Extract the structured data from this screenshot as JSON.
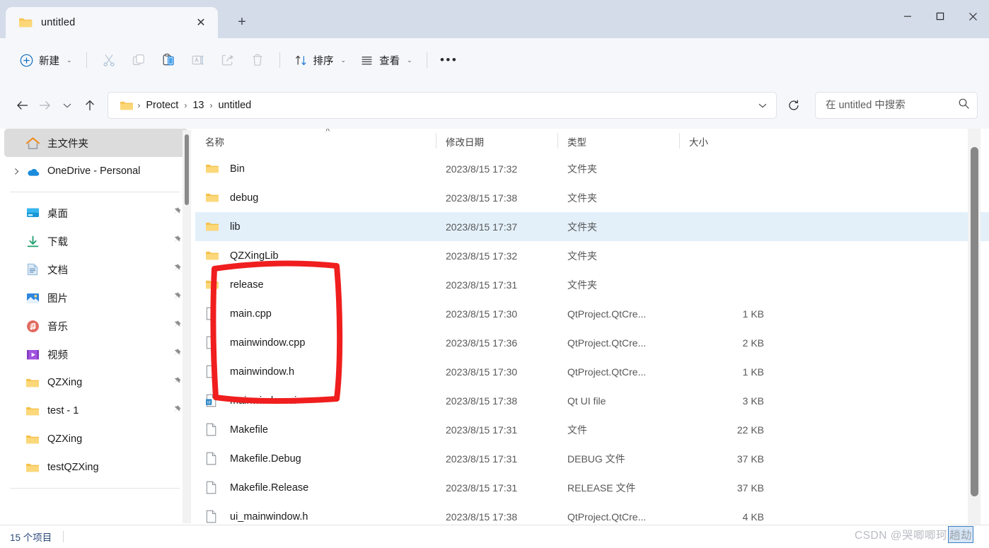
{
  "window": {
    "tab_title": "untitled",
    "tab_close_label": "✕",
    "new_tab_label": "+",
    "minimize_label": "─",
    "maximize_label": "□",
    "close_label": "✕"
  },
  "toolbar": {
    "new_label": "新建",
    "chevron": "⌄",
    "cut_name": "cut-icon",
    "copy_name": "copy-icon",
    "paste_name": "paste-icon",
    "rename_name": "rename-icon",
    "share_name": "share-icon",
    "delete_name": "delete-icon",
    "sort_label": "排序",
    "view_label": "查看",
    "more_label": "•••"
  },
  "address": {
    "back_label": "←",
    "forward_label": "→",
    "recent_label": "⌄",
    "up_label": "↑",
    "refresh_label": "⟳",
    "dropdown_label": "⌄",
    "crumbs": [
      "Protect",
      "13",
      "untitled"
    ],
    "crumb_sep": "›"
  },
  "search": {
    "placeholder": "在 untitled 中搜索",
    "value": "",
    "icon": "search-icon"
  },
  "sidebar": {
    "items": [
      {
        "label": "主文件夹",
        "icon": "home-icon",
        "selected": true,
        "expander": false,
        "pinned": false
      },
      {
        "label": "OneDrive - Personal",
        "icon": "onedrive-icon",
        "selected": false,
        "expander": true,
        "pinned": false
      },
      {
        "label": "桌面",
        "icon": "desktop-icon",
        "selected": false,
        "expander": false,
        "pinned": true
      },
      {
        "label": "下载",
        "icon": "downloads-icon",
        "selected": false,
        "expander": false,
        "pinned": true
      },
      {
        "label": "文档",
        "icon": "documents-icon",
        "selected": false,
        "expander": false,
        "pinned": true
      },
      {
        "label": "图片",
        "icon": "pictures-icon",
        "selected": false,
        "expander": false,
        "pinned": true
      },
      {
        "label": "音乐",
        "icon": "music-icon",
        "selected": false,
        "expander": false,
        "pinned": true
      },
      {
        "label": "视频",
        "icon": "videos-icon",
        "selected": false,
        "expander": false,
        "pinned": true
      },
      {
        "label": "QZXing",
        "icon": "folder-icon",
        "selected": false,
        "expander": false,
        "pinned": true
      },
      {
        "label": "test - 1",
        "icon": "folder-icon",
        "selected": false,
        "expander": false,
        "pinned": true
      },
      {
        "label": "QZXing",
        "icon": "folder-icon",
        "selected": false,
        "expander": false,
        "pinned": false
      },
      {
        "label": "testQZXing",
        "icon": "folder-icon",
        "selected": false,
        "expander": false,
        "pinned": false
      }
    ],
    "pin_glyph": "📌"
  },
  "filelist": {
    "columns": [
      {
        "key": "name",
        "label": "名称"
      },
      {
        "key": "date",
        "label": "修改日期"
      },
      {
        "key": "type",
        "label": "类型"
      },
      {
        "key": "size",
        "label": "大小"
      }
    ],
    "sort_indicator": "˄",
    "rows": [
      {
        "name": "Bin",
        "date": "2023/8/15 17:32",
        "type": "文件夹",
        "size": "",
        "icon": "folder-icon",
        "selected": false
      },
      {
        "name": "debug",
        "date": "2023/8/15 17:38",
        "type": "文件夹",
        "size": "",
        "icon": "folder-icon",
        "selected": false
      },
      {
        "name": "lib",
        "date": "2023/8/15 17:37",
        "type": "文件夹",
        "size": "",
        "icon": "folder-icon",
        "selected": true
      },
      {
        "name": "QZXingLib",
        "date": "2023/8/15 17:32",
        "type": "文件夹",
        "size": "",
        "icon": "folder-icon",
        "selected": false
      },
      {
        "name": "release",
        "date": "2023/8/15 17:31",
        "type": "文件夹",
        "size": "",
        "icon": "folder-icon",
        "selected": false
      },
      {
        "name": "main.cpp",
        "date": "2023/8/15 17:30",
        "type": "QtProject.QtCre...",
        "size": "1 KB",
        "icon": "file-icon",
        "selected": false
      },
      {
        "name": "mainwindow.cpp",
        "date": "2023/8/15 17:36",
        "type": "QtProject.QtCre...",
        "size": "2 KB",
        "icon": "file-icon",
        "selected": false
      },
      {
        "name": "mainwindow.h",
        "date": "2023/8/15 17:30",
        "type": "QtProject.QtCre...",
        "size": "1 KB",
        "icon": "file-icon",
        "selected": false
      },
      {
        "name": "mainwindow.ui",
        "date": "2023/8/15 17:38",
        "type": "Qt UI file",
        "size": "3 KB",
        "icon": "ui-file-icon",
        "selected": false
      },
      {
        "name": "Makefile",
        "date": "2023/8/15 17:31",
        "type": "文件",
        "size": "22 KB",
        "icon": "file-icon",
        "selected": false
      },
      {
        "name": "Makefile.Debug",
        "date": "2023/8/15 17:31",
        "type": "DEBUG 文件",
        "size": "37 KB",
        "icon": "file-icon",
        "selected": false
      },
      {
        "name": "Makefile.Release",
        "date": "2023/8/15 17:31",
        "type": "RELEASE 文件",
        "size": "37 KB",
        "icon": "file-icon",
        "selected": false
      },
      {
        "name": "ui_mainwindow.h",
        "date": "2023/8/15 17:38",
        "type": "QtProject.QtCre...",
        "size": "4 KB",
        "icon": "file-icon",
        "selected": false
      }
    ]
  },
  "statusbar": {
    "item_count": "15 个项目"
  },
  "watermark": {
    "prefix": "CSDN @哭唧唧珂",
    "boxed": "趟劫"
  },
  "colors": {
    "titlebar": "#d4dcea",
    "toolbar": "#f5f7fb",
    "selection": "#e3f0fa",
    "sidebar_selected": "#dcdcdc",
    "folder": "#ffd264",
    "accent": "#0f6cbd",
    "annotation_red": "#f01e1e"
  }
}
